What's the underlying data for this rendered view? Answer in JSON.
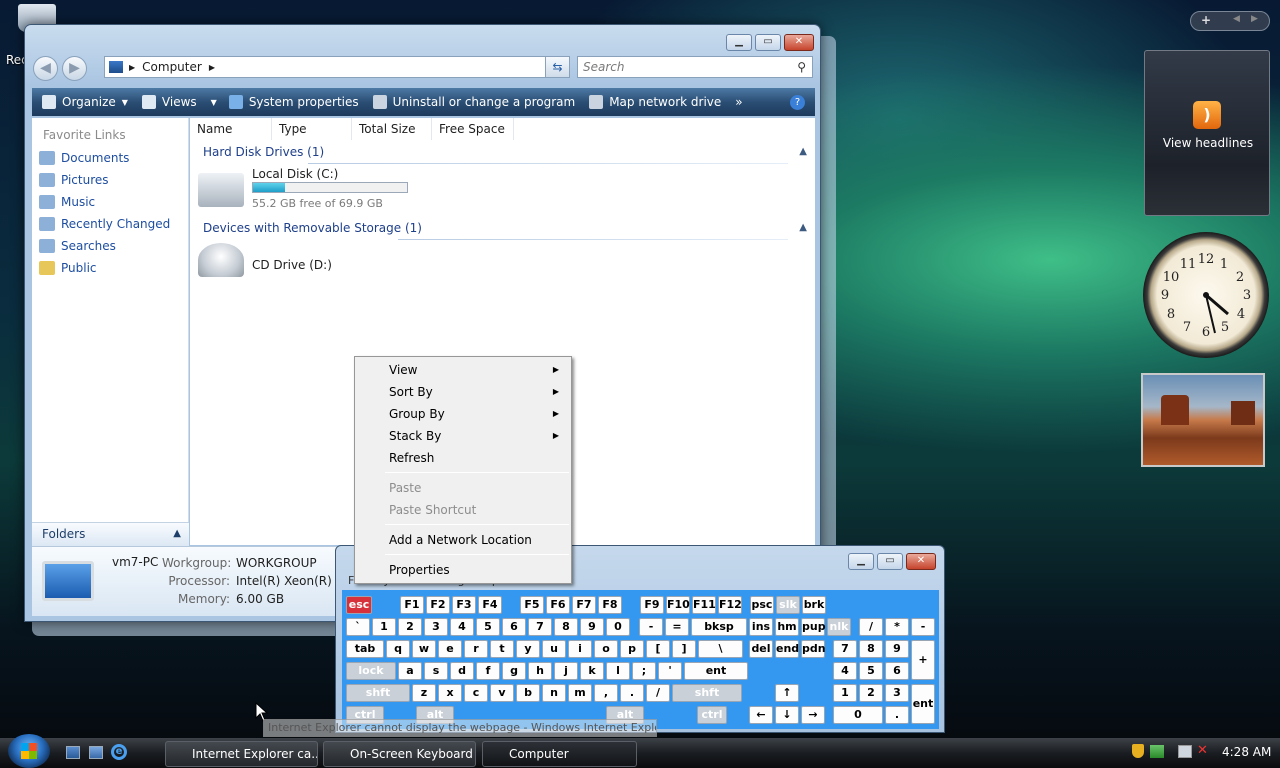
{
  "desktop": {
    "recycle_label": "Rec"
  },
  "explorer": {
    "address": "Computer",
    "search_placeholder": "Search",
    "toolbar": {
      "organize": "Organize",
      "views": "Views",
      "system_properties": "System properties",
      "uninstall": "Uninstall or change a program",
      "map_drive": "Map network drive",
      "more": "»",
      "help": "?"
    },
    "favorites_title": "Favorite Links",
    "favorites": [
      "Documents",
      "Pictures",
      "Music",
      "Recently Changed",
      "Searches",
      "Public"
    ],
    "folders_label": "Folders",
    "columns": [
      "Name",
      "Type",
      "Total Size",
      "Free Space"
    ],
    "groups": [
      {
        "title": "Hard Disk Drives (1)",
        "drive": "Local Disk (C:)",
        "free": "55.2 GB free of 69.9 GB",
        "used_fraction": 0.21
      },
      {
        "title": "Devices with Removable Storage (1)",
        "drive": "CD Drive (D:)"
      }
    ],
    "details": {
      "name": "vm7-PC",
      "workgroup_label": "Workgroup:",
      "workgroup": "WORKGROUP",
      "processor_label": "Processor:",
      "processor": "Intel(R) Xeon(R) CPU",
      "memory_label": "Memory:",
      "memory": "6.00 GB"
    }
  },
  "context_menu": {
    "items": [
      "View",
      "Sort By",
      "Group By",
      "Stack By",
      "Refresh"
    ],
    "disabled": [
      "Paste",
      "Paste Shortcut"
    ],
    "network": "Add a Network Location",
    "properties": "Properties"
  },
  "gadgets": {
    "rss_label": "View headlines",
    "pill_plus": "+",
    "clock_numbers": [
      "12",
      "1",
      "2",
      "3",
      "4",
      "5",
      "6",
      "7",
      "8",
      "9",
      "10",
      "11"
    ]
  },
  "osk": {
    "menu": "File  Keyboard  Settings  Help",
    "row0": [
      "esc",
      "F1",
      "F2",
      "F3",
      "F4",
      "F5",
      "F6",
      "F7",
      "F8",
      "F9",
      "F10",
      "F11",
      "F12",
      "psc",
      "slk",
      "brk"
    ],
    "row1": [
      "`",
      "1",
      "2",
      "3",
      "4",
      "5",
      "6",
      "7",
      "8",
      "9",
      "0",
      "-",
      "=",
      "bksp",
      "ins",
      "hm",
      "pup",
      "nlk",
      "/",
      "*",
      "-"
    ],
    "row2": [
      "tab",
      "q",
      "w",
      "e",
      "r",
      "t",
      "y",
      "u",
      "i",
      "o",
      "p",
      "[",
      "]",
      "\\",
      "del",
      "end",
      "pdn",
      "7",
      "8",
      "9",
      "+"
    ],
    "row3": [
      "lock",
      "a",
      "s",
      "d",
      "f",
      "g",
      "h",
      "j",
      "k",
      "l",
      ";",
      "'",
      "ent",
      "4",
      "5",
      "6"
    ],
    "row4": [
      "shft",
      "z",
      "x",
      "c",
      "v",
      "b",
      "n",
      "m",
      ",",
      ".",
      "/",
      "shft",
      "↑",
      "1",
      "2",
      "3",
      "ent"
    ],
    "row5": [
      "ctrl",
      "alt",
      "alt",
      "ctrl",
      "←",
      "↓",
      "→",
      "0",
      "."
    ]
  },
  "tooltip": "Internet Explorer cannot display the webpage - Windows Internet Explorer",
  "taskbar": {
    "items": [
      "Internet Explorer ca...",
      "On-Screen Keyboard",
      "Computer"
    ],
    "time": "4:28 AM"
  }
}
